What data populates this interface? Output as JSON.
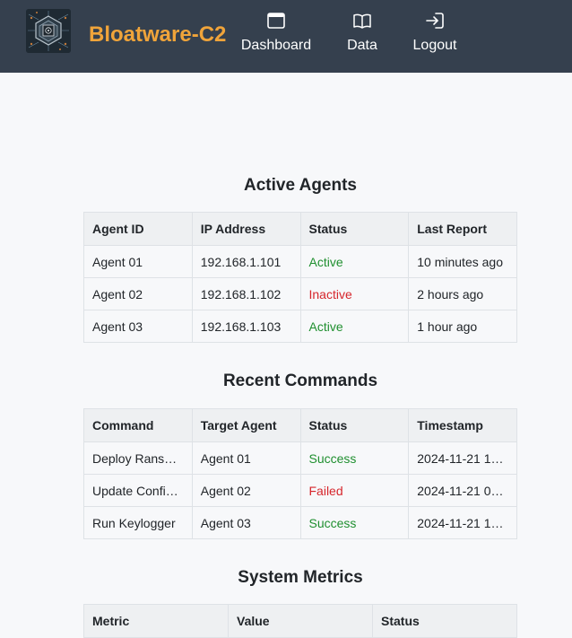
{
  "brand": {
    "name": "Bloatware-C2",
    "color": "#f0a43a"
  },
  "nav": [
    {
      "label": "Dashboard",
      "icon": "browser-window-icon"
    },
    {
      "label": "Data",
      "icon": "open-book-icon"
    },
    {
      "label": "Logout",
      "icon": "logout-arrow-icon"
    }
  ],
  "agents": {
    "title": "Active Agents",
    "headers": [
      "Agent ID",
      "IP Address",
      "Status",
      "Last Report"
    ],
    "rows": [
      [
        "Agent 01",
        "192.168.1.101",
        "Active",
        "10 minutes ago"
      ],
      [
        "Agent 02",
        "192.168.1.102",
        "Inactive",
        "2 hours ago"
      ],
      [
        "Agent 03",
        "192.168.1.103",
        "Active",
        "1 hour ago"
      ]
    ]
  },
  "commands": {
    "title": "Recent Commands",
    "headers": [
      "Command",
      "Target Agent",
      "Status",
      "Timestamp"
    ],
    "rows": [
      [
        "Deploy Rans…",
        "Agent 01",
        "Success",
        "2024-11-21 1…"
      ],
      [
        "Update Confi…",
        "Agent 02",
        "Failed",
        "2024-11-21 0…"
      ],
      [
        "Run Keylogger",
        "Agent 03",
        "Success",
        "2024-11-21 1…"
      ]
    ]
  },
  "metrics": {
    "title": "System Metrics",
    "headers": [
      "Metric",
      "Value",
      "Status"
    ]
  },
  "colors": {
    "success": "#1f8f2f",
    "failure": "#d6262c",
    "navbar": "#35404e"
  }
}
